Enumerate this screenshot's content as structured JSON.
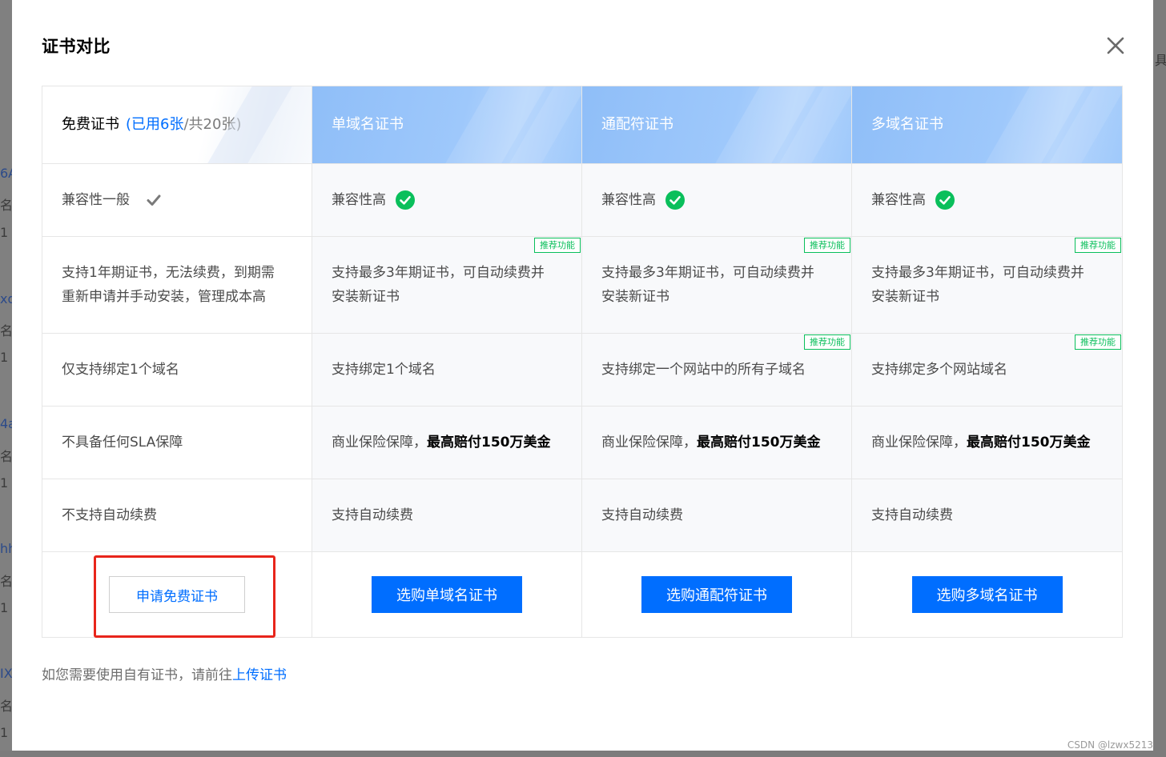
{
  "background": {
    "left_fragments": [
      "6A",
      "名",
      "1",
      "xq",
      "名",
      "1",
      "4a",
      "名",
      "1",
      "hh",
      "名",
      "1",
      "IX",
      "名",
      "1"
    ],
    "right_fragment": "具"
  },
  "modal": {
    "title": "证书对比",
    "close_icon": "close-icon"
  },
  "table": {
    "columns": [
      {
        "name": "免费证书",
        "used": "(已用6张",
        "total": "/共20张)"
      },
      {
        "name": "单域名证书"
      },
      {
        "name": "通配符证书"
      },
      {
        "name": "多域名证书"
      }
    ],
    "rows": {
      "compat": [
        "兼容性一般",
        "兼容性高",
        "兼容性高",
        "兼容性高"
      ],
      "period": [
        [
          "支持1年期证书，无法续费，到期需",
          "重新申请并手动安装，管理成本高"
        ],
        [
          "支持最多3年期证书，可自动续费并",
          "安装新证书"
        ],
        [
          "支持最多3年期证书，可自动续费并",
          "安装新证书"
        ],
        [
          "支持最多3年期证书，可自动续费并",
          "安装新证书"
        ]
      ],
      "domain": [
        "仅支持绑定1个域名",
        "支持绑定1个域名",
        "支持绑定一个网站中的所有子域名",
        "支持绑定多个网站域名"
      ],
      "sla": {
        "free": "不具备任何SLA保障",
        "paid_prefix": "商业保险保障，",
        "paid_strong": "最高赔付150万美金"
      },
      "renew": [
        "不支持自动续费",
        "支持自动续费",
        "支持自动续费",
        "支持自动续费"
      ]
    },
    "badge": "推荐功能",
    "buttons": [
      "申请免费证书",
      "选购单域名证书",
      "选购通配符证书",
      "选购多域名证书"
    ]
  },
  "footer": {
    "text": "如您需要使用自有证书，请前往",
    "link": "上传证书"
  },
  "watermark": "CSDN @lzwx5213",
  "colors": {
    "primary": "#006eff",
    "success": "#0abf5b",
    "header_blue": "#9ec8fb",
    "highlight_red": "#e8251b"
  }
}
